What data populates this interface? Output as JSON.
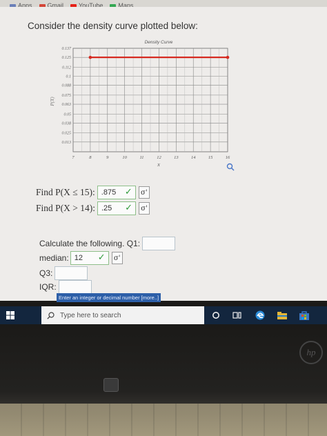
{
  "bookmarks": [
    {
      "label": "Apps",
      "icon": "apps-grid-icon",
      "color": "#6b7fb8"
    },
    {
      "label": "Gmail",
      "icon": "gmail-icon",
      "color": "#d44638"
    },
    {
      "label": "YouTube",
      "icon": "youtube-icon",
      "color": "#e62117"
    },
    {
      "label": "Maps",
      "icon": "maps-icon",
      "color": "#34a853"
    }
  ],
  "problem": {
    "prompt": "Consider the density curve plotted below:",
    "q1_label": "Find P(X ≤ 15):",
    "q1_value": ".875",
    "q2_label": "Find P(X > 14):",
    "q2_value": ".25",
    "calc_label": "Calculate the following. Q1:",
    "median_label": "median:",
    "median_value": "12",
    "q3_label": "Q3:",
    "iqr_label": "IQR:",
    "tooltip": "Enter an integer or decimal number [more..]",
    "check_symbol": "✓",
    "sigma_symbol": "σ'"
  },
  "chart_data": {
    "type": "line",
    "title": "Density Curve",
    "xlabel": "x",
    "ylabel": "P(X)",
    "x_ticks": [
      "7",
      "8",
      "9",
      "10",
      "11",
      "12",
      "13",
      "14",
      "15",
      "16"
    ],
    "y_ticks": [
      "0.137",
      "0.125",
      "0.112",
      "0.1",
      "0.088",
      "0.075",
      "0.063",
      "0.05",
      "0.038",
      "0.025",
      "0.013"
    ],
    "xlim": [
      7,
      16
    ],
    "ylim": [
      0,
      0.137
    ],
    "grid": true,
    "series": [
      {
        "x": [
          8,
          16
        ],
        "y": [
          0.125,
          0.125
        ],
        "color": "#d62a20"
      }
    ]
  },
  "taskbar": {
    "search_placeholder": "Type here to search"
  },
  "accent": {
    "correct": "#2f9a3a",
    "tooltip_bg": "#2d5fa8",
    "taskbar_bg": "#13263e"
  }
}
